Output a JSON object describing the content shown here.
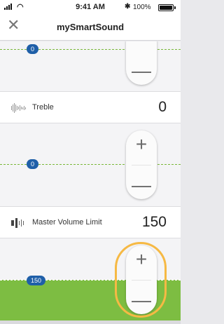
{
  "status_bar": {
    "time": "9:41 AM",
    "battery_text": "100%",
    "bluetooth_icon": "bluetooth-icon",
    "wifi_icon": "wifi-icon",
    "signal_icon": "signal-icon"
  },
  "nav": {
    "title": "mySmartSound",
    "close_icon": "close-icon"
  },
  "top_slider": {
    "value_label": "0",
    "minus": "—"
  },
  "treble": {
    "label": "Treble",
    "value": "0",
    "icon": "treble-icon",
    "slider_value_label": "0",
    "plus": "+",
    "minus": "—"
  },
  "master_volume": {
    "label": "Master Volume Limit",
    "value": "150",
    "icon": "volume-icon",
    "slider_value_label": "150",
    "plus": "+",
    "minus": "—"
  },
  "colors": {
    "accent_green": "#7dbd42",
    "pill_blue": "#1f5fa8",
    "highlight_orange": "#f6b944"
  }
}
